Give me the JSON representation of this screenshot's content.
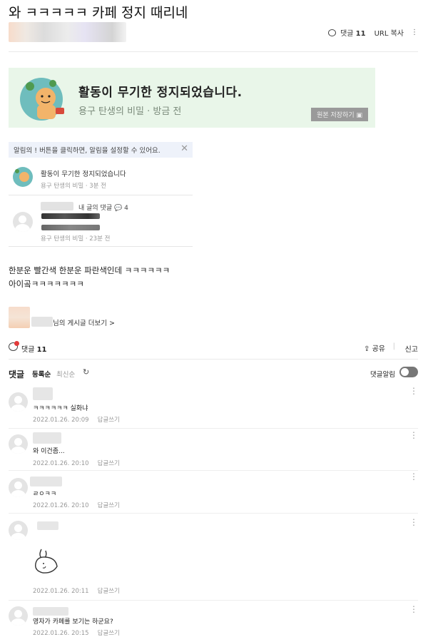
{
  "post": {
    "title": "와 ㅋㅋㅋㅋㅋ 카페 정지 때리네",
    "comment_label": "댓글",
    "comment_count": "11",
    "url_copy": "URL 복사"
  },
  "banner": {
    "main": "활동이 무기한 정지되었습니다.",
    "sub": "용구 탄생의 비밀 · 방금 전",
    "save_button": "원본 저장하기"
  },
  "notifications": {
    "notice": "알림의 ! 버튼을 클릭하면, 알림을 설정할 수 있어요.",
    "items": [
      {
        "line1": "활동이 무기한 정지되었습니다",
        "line2": "용구 탄생의 비밀 · 3분 전"
      },
      {
        "line1": "내 글의 댓글",
        "count": "4",
        "line2": "용구 탄생의 비밀 · 23분 전"
      }
    ]
  },
  "body": {
    "lines": [
      "한분운 빨간색 한분운 파란색인데 ㅋㅋㅋㅋㅋㅋ",
      "아이곸ㅋㅋㅋㅋㅋㅋㅋ"
    ]
  },
  "more_posts": "님의 게시글 더보기 >",
  "actions": {
    "comment_label": "댓글",
    "comment_count": "11",
    "share": "공유",
    "report": "신고"
  },
  "comments_section": {
    "heading": "댓글",
    "sort_selected": "등록순",
    "sort_other": "최신순",
    "alarm_label": "댓글알림"
  },
  "comments": [
    {
      "text": "ㅋㅋㅋㅋㅋㅋ 실화냐",
      "date": "2022.01.26. 20:09",
      "reply": "답글쓰기"
    },
    {
      "text": "와 이건좀...",
      "date": "2022.01.26. 20:10",
      "reply": "답글쓰기"
    },
    {
      "text": "ㄹㅇㅋㅋ",
      "date": "2022.01.26. 20:10",
      "reply": "답글쓰기"
    },
    {
      "text": "",
      "date": "2022.01.26. 20:11",
      "reply": "답글쓰기",
      "has_sticker": true
    },
    {
      "text": "영자가 카페를 보기는 하군요?",
      "date": "2022.01.26. 20:15",
      "reply": "답글쓰기"
    }
  ]
}
